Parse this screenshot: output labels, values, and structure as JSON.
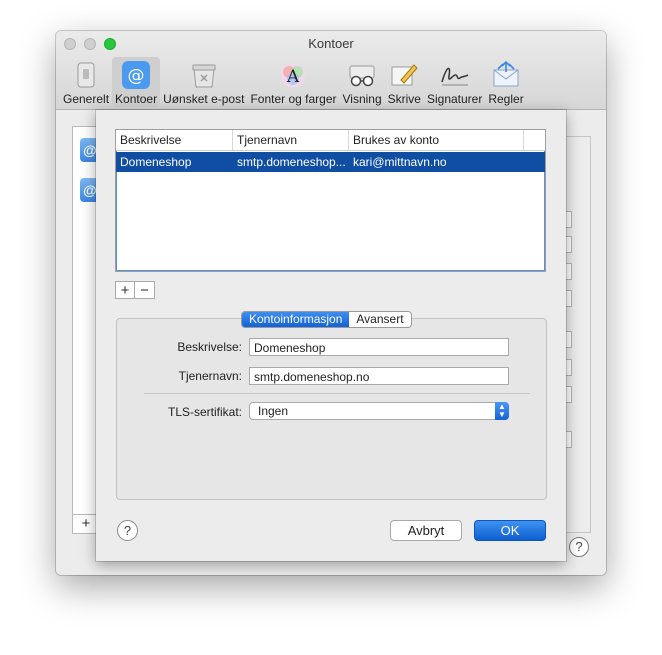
{
  "window": {
    "title": "Kontoer"
  },
  "toolbar": {
    "items": [
      {
        "label": "Generelt",
        "icon": "switch-icon"
      },
      {
        "label": "Kontoer",
        "icon": "at-icon",
        "active": true
      },
      {
        "label": "Uønsket e-post",
        "icon": "junk-mail-icon"
      },
      {
        "label": "Fonter og farger",
        "icon": "font-colors-icon"
      },
      {
        "label": "Visning",
        "icon": "glasses-icon"
      },
      {
        "label": "Skrive",
        "icon": "pencil-icon"
      },
      {
        "label": "Signaturer",
        "icon": "signature-icon"
      },
      {
        "label": "Regler",
        "icon": "rules-icon"
      }
    ]
  },
  "background": {
    "add_label": "+",
    "help_label": "?"
  },
  "sheet": {
    "table": {
      "columns": [
        "Beskrivelse",
        "Tjenernavn",
        "Brukes av konto"
      ],
      "rows": [
        {
          "description": "Domeneshop",
          "server": "smtp.domeneshop...",
          "account": "kari@mittnavn.no"
        }
      ]
    },
    "add_label": "+",
    "remove_label": "−",
    "tabs": {
      "info": "Kontoinformasjon",
      "advanced": "Avansert"
    },
    "form": {
      "description_label": "Beskrivelse:",
      "description_value": "Domeneshop",
      "server_label": "Tjenernavn:",
      "server_value": "smtp.domeneshop.no",
      "tls_label": "TLS-sertifikat:",
      "tls_value": "Ingen"
    },
    "help_label": "?",
    "cancel_label": "Avbryt",
    "ok_label": "OK"
  }
}
